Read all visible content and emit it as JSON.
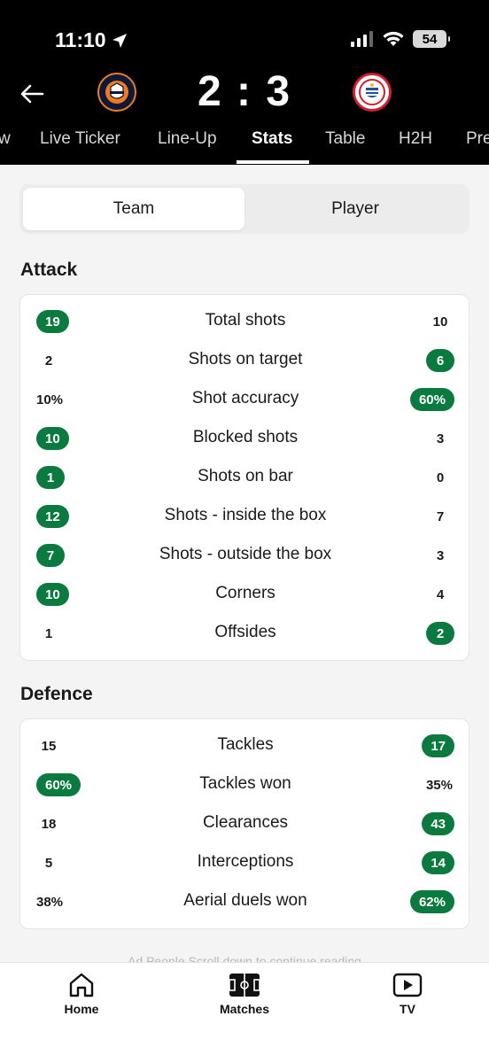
{
  "status_bar": {
    "time": "11:10",
    "battery": "54"
  },
  "match": {
    "score": "2 : 3"
  },
  "tabs": [
    {
      "label": "w"
    },
    {
      "label": "Live Ticker"
    },
    {
      "label": "Line-Up"
    },
    {
      "label": "Stats"
    },
    {
      "label": "Table"
    },
    {
      "label": "H2H"
    },
    {
      "label": "Pre"
    }
  ],
  "toggle": {
    "team": "Team",
    "player": "Player"
  },
  "attack": {
    "title": "Attack",
    "rows": [
      {
        "label": "Total shots",
        "home": "19",
        "away": "10",
        "leader": "home"
      },
      {
        "label": "Shots on target",
        "home": "2",
        "away": "6",
        "leader": "away"
      },
      {
        "label": "Shot accuracy",
        "home": "10%",
        "away": "60%",
        "leader": "away"
      },
      {
        "label": "Blocked shots",
        "home": "10",
        "away": "3",
        "leader": "home"
      },
      {
        "label": "Shots on bar",
        "home": "1",
        "away": "0",
        "leader": "home"
      },
      {
        "label": "Shots - inside the box",
        "home": "12",
        "away": "7",
        "leader": "home"
      },
      {
        "label": "Shots - outside the box",
        "home": "7",
        "away": "3",
        "leader": "home"
      },
      {
        "label": "Corners",
        "home": "10",
        "away": "4",
        "leader": "home"
      },
      {
        "label": "Offsides",
        "home": "1",
        "away": "2",
        "leader": "away"
      }
    ]
  },
  "defence": {
    "title": "Defence",
    "rows": [
      {
        "label": "Tackles",
        "home": "15",
        "away": "17",
        "leader": "away"
      },
      {
        "label": "Tackles won",
        "home": "60%",
        "away": "35%",
        "leader": "home"
      },
      {
        "label": "Clearances",
        "home": "18",
        "away": "43",
        "leader": "away"
      },
      {
        "label": "Interceptions",
        "home": "5",
        "away": "14",
        "leader": "away"
      },
      {
        "label": "Aerial duels won",
        "home": "38%",
        "away": "62%",
        "leader": "away"
      }
    ]
  },
  "ad_text": "Ad People Scroll down to continue reading",
  "bottom_nav": {
    "home": "Home",
    "matches": "Matches",
    "tv": "TV"
  },
  "colors": {
    "leader_pill": "#0b7a3e",
    "header_bg": "#000000"
  },
  "icons": [
    "back-arrow-icon",
    "location-arrow-icon",
    "signal-icon",
    "wifi-icon",
    "battery-icon",
    "home-icon",
    "pitch-icon",
    "tv-play-icon"
  ]
}
